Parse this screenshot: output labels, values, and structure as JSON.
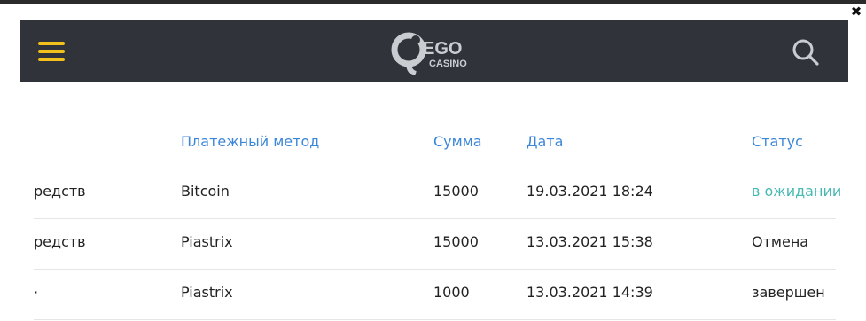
{
  "header": {
    "logo_text_top": "EGO",
    "logo_text_bottom": "CASINO"
  },
  "icons": {
    "menu": "hamburger-menu-icon",
    "search": "search-icon",
    "close": "close-icon"
  },
  "close_label": "✖",
  "colors": {
    "header_bg": "#30343a",
    "menu_accent": "#f4c01b",
    "link_blue": "#3a86d8",
    "pending_teal": "#47b9b3"
  },
  "table": {
    "columns": [
      "",
      "Платежный метод",
      "Сумма",
      "Дата",
      "Статус"
    ],
    "rows": [
      {
        "col0": "редств",
        "method": "Bitcoin",
        "amount": "15000",
        "date": "19.03.2021 18:24",
        "status": "в ожидании"
      },
      {
        "col0": "редств",
        "method": "Piastrix",
        "amount": "15000",
        "date": "13.03.2021 15:38",
        "status": "Отмена"
      },
      {
        "col0": "·",
        "method": "Piastrix",
        "amount": "1000",
        "date": "13.03.2021 14:39",
        "status": "завершен"
      }
    ]
  }
}
